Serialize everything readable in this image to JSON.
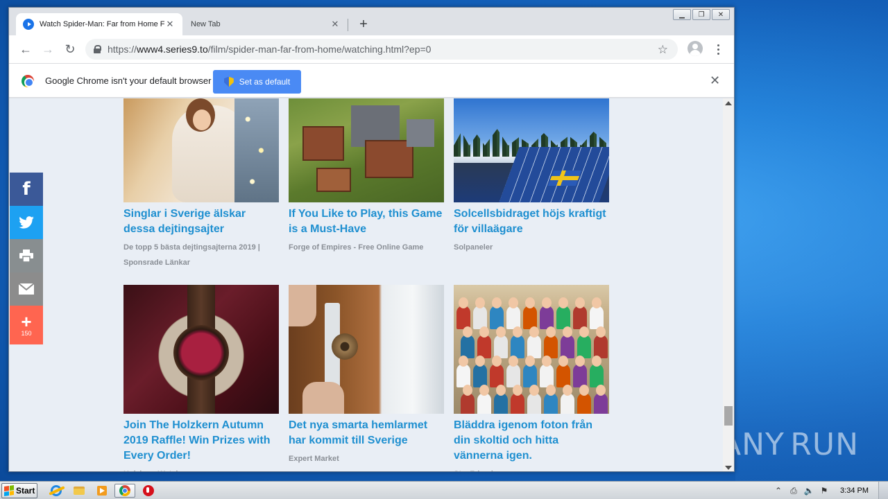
{
  "browser": {
    "tabs": [
      {
        "title": "Watch Spider-Man: Far from Home F",
        "close": "✕"
      },
      {
        "title": "New Tab",
        "close": "✕"
      }
    ],
    "new_tab_label": "+",
    "url_scheme": "https://",
    "url_host": "www4.series9.to",
    "url_path": "/film/spider-man-far-from-home/watching.html?ep=0",
    "infobar": {
      "message": "Google Chrome isn't your default browser",
      "button_label": "Set as default",
      "close": "✕"
    }
  },
  "ads": [
    {
      "title": "Singlar i Sverige älskar dessa dejtingsajter",
      "source": "De topp 5 bästa dejtingsajterna 2019 | Sponsrade Länkar"
    },
    {
      "title": "If You Like to Play, this Game is a Must-Have",
      "source": "Forge of Empires - Free Online Game"
    },
    {
      "title": "Solcellsbidraget höjs kraftigt för villaägare",
      "source": "Solpaneler"
    },
    {
      "title": "Join The Holzkern Autumn 2019 Raffle! Win Prizes with Every Order!",
      "source": "Holzkern Watches"
    },
    {
      "title": "Det nya smarta hemlarmet har kommit till Sverige",
      "source": "Expert Market"
    },
    {
      "title": "Bläddra igenom foton från din skoltid och hitta vännerna igen.",
      "source": "StayFriends"
    }
  ],
  "share": {
    "facebook": "f",
    "more_plus": "+",
    "count": "150"
  },
  "taskbar": {
    "start_label": "Start",
    "clock": "3:34 PM"
  },
  "watermark": {
    "left": "ANY",
    "right": "RUN"
  },
  "colors": {
    "link": "#1e8fd0",
    "facebook": "#3b5998",
    "twitter": "#1da1f2",
    "more": "#ff6550",
    "chrome_button": "#4a8af4"
  }
}
